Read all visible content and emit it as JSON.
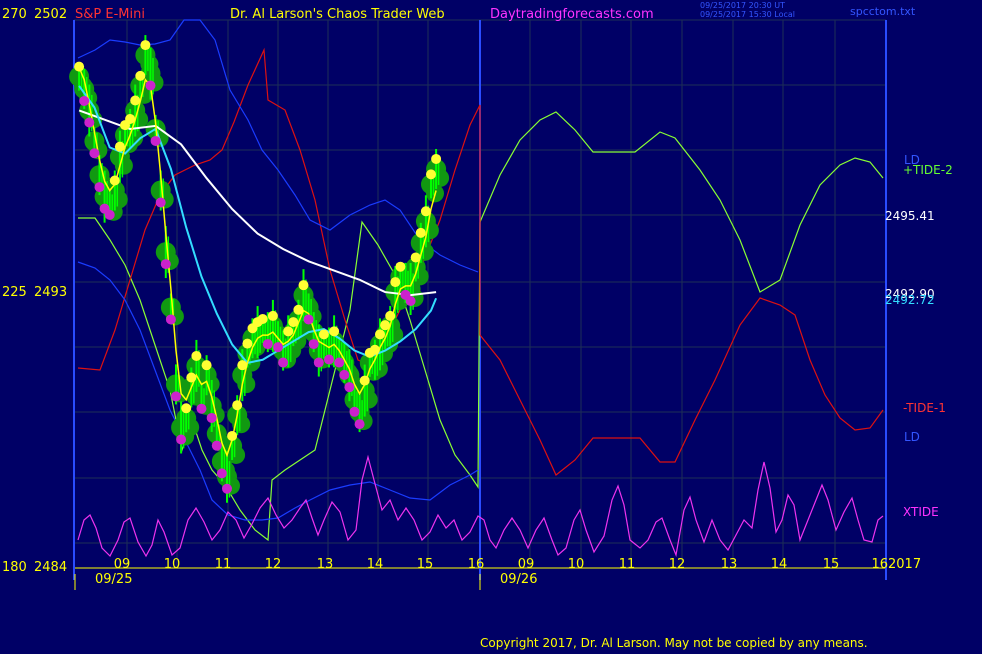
{
  "header": {
    "instrument": "S&P E-Mini",
    "site_title": "Dr. Al Larson's Chaos Trader Web",
    "site_url": "Daytradingforecasts.com",
    "timestamp_ut": "09/25/2017 20:30 UT",
    "timestamp_local": "09/25/2017 15:30 Local",
    "file_name": "spcctom.txt"
  },
  "footer": {
    "copyright": "Copyright 2017, Dr. Al Larson. May not be copied by any means."
  },
  "colors": {
    "background": "#000066",
    "grid": "#1e2f56",
    "price_bars": "#00ff00",
    "highlight_circles": "#119911",
    "yellow_markers": "#ffff33",
    "magenta_markers": "#cc22cc",
    "fast_ma": "#ffff00",
    "cyan_ma": "#33ddff",
    "white_ma": "#ffffff",
    "blue_band": "#1a3cff",
    "tide_plus": "#88ff33",
    "tide_minus": "#dd1111",
    "xtide": "#ee33ee",
    "axis_text": "#ffff00",
    "vertical_marker": "#2a4cff",
    "instrument_text": "#ff3333",
    "url_text": "#ff33ff",
    "copyright_text": "#ffff00",
    "stamp_text": "#3355ff",
    "right_label_blue": "#3355ff",
    "plus_tide_label": "#66ff33",
    "minus_tide_label": "#ff3333",
    "xtide_label": "#ff33ff",
    "price_label": "#ffffff"
  },
  "chart_data": {
    "type": "line",
    "title": "S&P E-Mini",
    "xlabel": "",
    "ylabel": "",
    "ylim": [
      2484,
      2502
    ],
    "left_scale_ticks": [
      {
        "index": "270",
        "price": "2502"
      },
      {
        "index": "225",
        "price": "2493"
      },
      {
        "index": "180",
        "price": "2484"
      }
    ],
    "hour_ticks": [
      "09",
      "10",
      "11",
      "12",
      "13",
      "14",
      "15",
      "16",
      "09",
      "10",
      "11",
      "12",
      "13",
      "14",
      "15",
      "16"
    ],
    "date_labels": [
      "09/25",
      "09/26"
    ],
    "year_label": "2017",
    "right_labels": {
      "ld_upper": "LD",
      "tide_plus": "+TIDE-2",
      "price_a": "2495.41",
      "price_b": "2492.90",
      "price_c": "2492.72",
      "tide_minus": "-TIDE-1",
      "ld_lower": "LD",
      "xtide": "XTIDE"
    },
    "series": [
      {
        "name": "Price",
        "x": [
          9.0,
          9.1,
          9.2,
          9.3,
          9.4,
          9.5,
          9.6,
          9.7,
          9.8,
          9.9,
          10.0,
          10.1,
          10.2,
          10.3,
          10.4,
          10.5,
          10.6,
          10.7,
          10.8,
          10.9,
          11.0,
          11.1,
          11.2,
          11.3,
          11.4,
          11.5,
          11.6,
          11.7,
          11.8,
          11.9,
          12.0,
          12.1,
          12.2,
          12.3,
          12.4,
          12.5,
          12.6,
          12.7,
          12.8,
          12.9,
          13.0,
          13.1,
          13.2,
          13.3,
          13.4,
          13.5,
          13.6,
          13.7,
          13.8,
          13.9,
          14.0,
          14.1,
          14.2,
          14.3,
          14.4,
          14.5,
          14.6,
          14.7,
          14.8,
          14.9,
          15.0,
          15.1,
          15.2,
          15.3,
          15.4,
          15.5,
          15.6,
          15.7,
          15.8,
          15.9,
          16.0
        ],
        "y": [
          2499.9,
          2499.5,
          2498.8,
          2497.8,
          2496.7,
          2496.0,
          2495.8,
          2496.2,
          2497.3,
          2498.0,
          2498.2,
          2498.8,
          2499.6,
          2500.6,
          2500.0,
          2498.2,
          2496.2,
          2494.2,
          2492.4,
          2489.9,
          2488.5,
          2488.8,
          2489.8,
          2490.5,
          2489.5,
          2490.2,
          2489.2,
          2488.3,
          2487.4,
          2486.9,
          2487.9,
          2488.9,
          2490.2,
          2490.9,
          2491.4,
          2491.6,
          2491.7,
          2491.6,
          2491.8,
          2491.5,
          2491.0,
          2491.3,
          2491.6,
          2492.0,
          2492.8,
          2492.4,
          2491.6,
          2491.0,
          2491.2,
          2491.1,
          2491.3,
          2491.0,
          2490.6,
          2490.2,
          2489.4,
          2489.0,
          2489.7,
          2490.6,
          2490.7,
          2491.2,
          2491.5,
          2491.8,
          2492.9,
          2493.4,
          2493.2,
          2493.0,
          2493.7,
          2494.5,
          2495.2,
          2496.4,
          2496.9
        ]
      },
      {
        "name": "Fast Average",
        "x": [
          9.0,
          9.1,
          9.2,
          9.3,
          9.4,
          9.5,
          9.6,
          9.7,
          9.8,
          9.9,
          10.0,
          10.1,
          10.2,
          10.3,
          10.4,
          10.5,
          10.6,
          10.7,
          10.8,
          10.9,
          11.0,
          11.1,
          11.2,
          11.3,
          11.4,
          11.5,
          11.6,
          11.7,
          11.8,
          11.9,
          12.0,
          12.1,
          12.2,
          12.3,
          12.4,
          12.5,
          12.6,
          12.7,
          12.8,
          12.9,
          13.0,
          13.1,
          13.2,
          13.3,
          13.4,
          13.5,
          13.6,
          13.7,
          13.8,
          13.9,
          14.0,
          14.1,
          14.2,
          14.3,
          14.4,
          14.5,
          14.6,
          14.7,
          14.8,
          14.9,
          15.0,
          15.1,
          15.2,
          15.3,
          15.4,
          15.5,
          15.6,
          15.7,
          15.8,
          15.9,
          16.0
        ],
        "y": [
          2500.2,
          2499.8,
          2499.0,
          2498.1,
          2497.2,
          2496.5,
          2496.2,
          2496.4,
          2497.0,
          2497.6,
          2498.0,
          2498.5,
          2499.1,
          2499.8,
          2499.6,
          2498.4,
          2496.7,
          2494.8,
          2493.0,
          2491.0,
          2489.6,
          2489.4,
          2489.8,
          2490.2,
          2489.9,
          2490.0,
          2489.5,
          2488.8,
          2488.0,
          2487.6,
          2488.1,
          2488.9,
          2489.9,
          2490.6,
          2491.1,
          2491.4,
          2491.5,
          2491.5,
          2491.6,
          2491.4,
          2491.2,
          2491.3,
          2491.5,
          2491.9,
          2492.3,
          2492.2,
          2491.7,
          2491.3,
          2491.2,
          2491.1,
          2491.2,
          2491.0,
          2490.7,
          2490.4,
          2489.9,
          2489.6,
          2489.9,
          2490.4,
          2490.7,
          2491.1,
          2491.4,
          2491.8,
          2492.5,
          2493.0,
          2493.1,
          2493.1,
          2493.5,
          2494.1,
          2494.7,
          2495.6,
          2496.2
        ]
      },
      {
        "name": "Medium Average",
        "x": [
          9.0,
          9.3,
          9.6,
          9.9,
          10.2,
          10.5,
          10.8,
          11.1,
          11.4,
          11.7,
          12.0,
          12.3,
          12.6,
          12.9,
          13.2,
          13.5,
          13.8,
          14.1,
          14.4,
          14.7,
          15.0,
          15.3,
          15.6,
          15.9,
          16.0
        ],
        "y": [
          2499.6,
          2498.9,
          2497.6,
          2497.4,
          2497.9,
          2498.2,
          2496.9,
          2495.0,
          2493.4,
          2492.2,
          2491.2,
          2490.6,
          2490.7,
          2491.0,
          2491.3,
          2491.6,
          2491.7,
          2491.4,
          2491.0,
          2490.8,
          2491.0,
          2491.3,
          2491.7,
          2492.3,
          2492.7
        ]
      },
      {
        "name": "Slow Average",
        "x": [
          9.0,
          9.5,
          10.0,
          10.5,
          11.0,
          11.5,
          12.0,
          12.5,
          13.0,
          13.5,
          14.0,
          14.5,
          15.0,
          15.5,
          16.0
        ],
        "y": [
          2498.8,
          2498.5,
          2498.2,
          2498.3,
          2497.7,
          2496.6,
          2495.6,
          2494.8,
          2494.3,
          2493.9,
          2493.6,
          2493.3,
          2492.9,
          2492.8,
          2492.9
        ]
      }
    ]
  }
}
